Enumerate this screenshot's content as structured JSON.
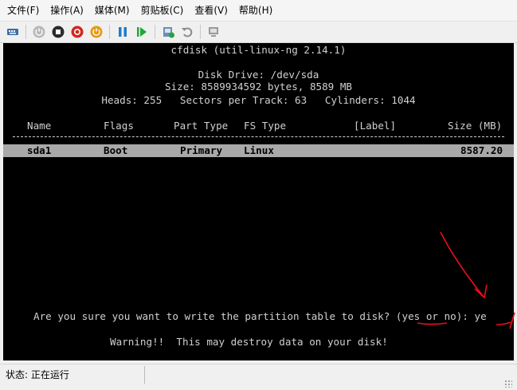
{
  "menu": [
    {
      "label": "文件(F)"
    },
    {
      "label": "操作(A)"
    },
    {
      "label": "媒体(M)"
    },
    {
      "label": "剪贴板(C)"
    },
    {
      "label": "查看(V)"
    },
    {
      "label": "帮助(H)"
    }
  ],
  "toolbar": {
    "icons": [
      "ctrl-alt-del-icon",
      "start-icon",
      "stop-icon",
      "shutdown-icon",
      "power-icon",
      "pause-icon",
      "reset-icon",
      "checkpoint-icon",
      "revert-icon",
      "enhanced-session-icon"
    ]
  },
  "terminal": {
    "title": "cfdisk (util-linux-ng 2.14.1)",
    "disk_drive": "Disk Drive: /dev/sda",
    "size": "Size: 8589934592 bytes, 8589 MB",
    "geometry": "Heads: 255   Sectors per Track: 63   Cylinders: 1044",
    "columns": {
      "name": "Name",
      "flags": "Flags",
      "part_type": "Part Type",
      "fs_type": "FS Type",
      "label": "[Label]",
      "size": "Size (MB)"
    },
    "rows": [
      {
        "name": "sda1",
        "flags": "Boot",
        "part_type": "Primary",
        "fs_type": "Linux",
        "label": "",
        "size": "8587.20"
      }
    ],
    "prompt": "Are you sure you want to write the partition table to disk? (yes or no): ye",
    "warning": "Warning!!  This may destroy data on your disk!"
  },
  "status": {
    "text": "状态: 正在运行"
  },
  "colors": {
    "terminal_bg": "#000000",
    "terminal_fg": "#d0d0d0",
    "selected_row": "#a9a9a9",
    "annotation": "#e8101a"
  }
}
